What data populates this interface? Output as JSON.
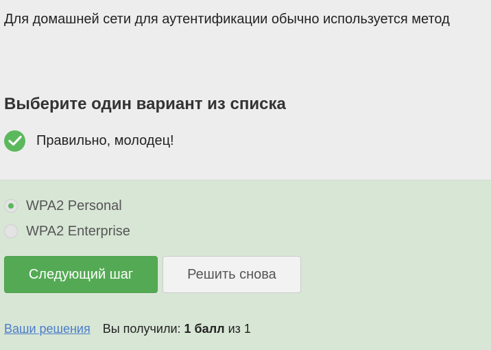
{
  "question": {
    "text": "Для домашней сети для аутентификации обычно используется метод"
  },
  "instruction": {
    "heading": "Выберите один вариант из списка"
  },
  "feedback": {
    "icon": "check-icon",
    "text": "Правильно, молодец!",
    "color": "#5cb85c"
  },
  "options": [
    {
      "label": "WPA2 Personal",
      "selected": true
    },
    {
      "label": "WPA2 Enterprise",
      "selected": false
    }
  ],
  "buttons": {
    "next_label": "Следующий шаг",
    "retry_label": "Решить снова"
  },
  "footer": {
    "solutions_link": "Ваши решения",
    "score_prefix": "Вы получили: ",
    "score_value": "1 балл",
    "score_suffix": " из 1"
  },
  "colors": {
    "accent_green": "#54aa54",
    "panel_background": "#d8e6d5",
    "page_background": "#ededed",
    "link": "#4a7cc9"
  }
}
